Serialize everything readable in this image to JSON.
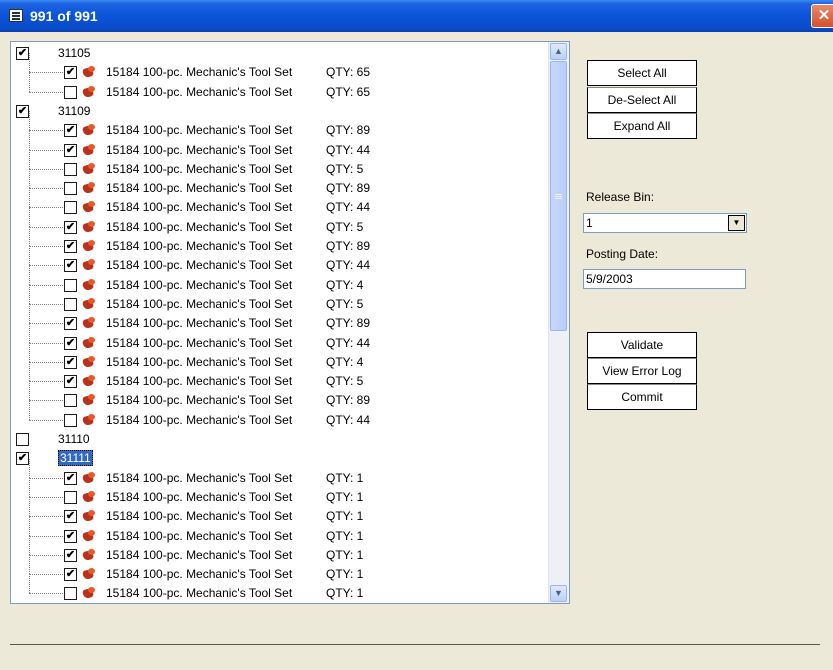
{
  "window": {
    "title": "991 of 991",
    "close_label": "✕"
  },
  "tree": [
    {
      "type": "group",
      "label": "31105",
      "checked": true
    },
    {
      "type": "item",
      "label": "15184 100-pc. Mechanic's Tool Set",
      "qty": "QTY: 65",
      "checked": true
    },
    {
      "type": "item",
      "label": "15184 100-pc. Mechanic's Tool Set",
      "qty": "QTY: 65",
      "checked": false
    },
    {
      "type": "group",
      "label": "31109",
      "checked": true
    },
    {
      "type": "item",
      "label": "15184 100-pc. Mechanic's Tool Set",
      "qty": "QTY: 89",
      "checked": true
    },
    {
      "type": "item",
      "label": "15184 100-pc. Mechanic's Tool Set",
      "qty": "QTY: 44",
      "checked": true
    },
    {
      "type": "item",
      "label": "15184 100-pc. Mechanic's Tool Set",
      "qty": "QTY: 5",
      "checked": false
    },
    {
      "type": "item",
      "label": "15184 100-pc. Mechanic's Tool Set",
      "qty": "QTY: 89",
      "checked": false
    },
    {
      "type": "item",
      "label": "15184 100-pc. Mechanic's Tool Set",
      "qty": "QTY: 44",
      "checked": false
    },
    {
      "type": "item",
      "label": "15184 100-pc. Mechanic's Tool Set",
      "qty": "QTY: 5",
      "checked": true
    },
    {
      "type": "item",
      "label": "15184 100-pc. Mechanic's Tool Set",
      "qty": "QTY: 89",
      "checked": true
    },
    {
      "type": "item",
      "label": "15184 100-pc. Mechanic's Tool Set",
      "qty": "QTY: 44",
      "checked": true
    },
    {
      "type": "item",
      "label": "15184 100-pc. Mechanic's Tool Set",
      "qty": "QTY: 4",
      "checked": false
    },
    {
      "type": "item",
      "label": "15184 100-pc. Mechanic's Tool Set",
      "qty": "QTY: 5",
      "checked": false
    },
    {
      "type": "item",
      "label": "15184 100-pc. Mechanic's Tool Set",
      "qty": "QTY: 89",
      "checked": true
    },
    {
      "type": "item",
      "label": "15184 100-pc. Mechanic's Tool Set",
      "qty": "QTY: 44",
      "checked": true
    },
    {
      "type": "item",
      "label": "15184 100-pc. Mechanic's Tool Set",
      "qty": "QTY: 4",
      "checked": true
    },
    {
      "type": "item",
      "label": "15184 100-pc. Mechanic's Tool Set",
      "qty": "QTY: 5",
      "checked": true
    },
    {
      "type": "item",
      "label": "15184 100-pc. Mechanic's Tool Set",
      "qty": "QTY: 89",
      "checked": false
    },
    {
      "type": "item",
      "label": "15184 100-pc. Mechanic's Tool Set",
      "qty": "QTY: 44",
      "checked": false
    },
    {
      "type": "group",
      "label": "31110",
      "checked": false
    },
    {
      "type": "group",
      "label": "31111",
      "checked": true,
      "selected": true
    },
    {
      "type": "item",
      "label": "15184 100-pc. Mechanic's Tool Set",
      "qty": "QTY: 1",
      "checked": true
    },
    {
      "type": "item",
      "label": "15184 100-pc. Mechanic's Tool Set",
      "qty": "QTY: 1",
      "checked": false
    },
    {
      "type": "item",
      "label": "15184 100-pc. Mechanic's Tool Set",
      "qty": "QTY: 1",
      "checked": true
    },
    {
      "type": "item",
      "label": "15184 100-pc. Mechanic's Tool Set",
      "qty": "QTY: 1",
      "checked": true
    },
    {
      "type": "item",
      "label": "15184 100-pc. Mechanic's Tool Set",
      "qty": "QTY: 1",
      "checked": true
    },
    {
      "type": "item",
      "label": "15184 100-pc. Mechanic's Tool Set",
      "qty": "QTY: 1",
      "checked": true
    },
    {
      "type": "item",
      "label": "15184 100-pc. Mechanic's Tool Set",
      "qty": "QTY: 1",
      "checked": false
    }
  ],
  "scrollbar": {
    "up_glyph": "▲",
    "down_glyph": "▼"
  },
  "actions": {
    "select_all": "Select All",
    "deselect_all": "De-Select All",
    "expand_all": "Expand All",
    "validate": "Validate",
    "view_error_log": "View Error Log",
    "commit": "Commit"
  },
  "release_bin": {
    "label": "Release Bin:",
    "value": "1",
    "dropdown_glyph": "▼"
  },
  "posting_date": {
    "label": "Posting Date:",
    "value": "5/9/2003"
  }
}
